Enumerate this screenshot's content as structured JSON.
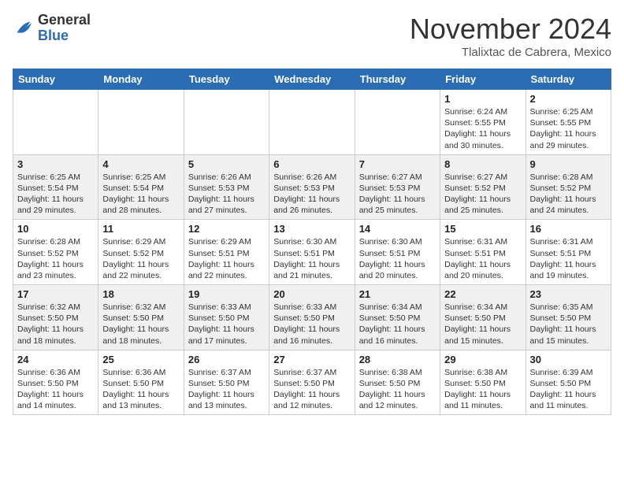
{
  "header": {
    "logo_general": "General",
    "logo_blue": "Blue",
    "month_title": "November 2024",
    "location": "Tlalixtac de Cabrera, Mexico"
  },
  "weekdays": [
    "Sunday",
    "Monday",
    "Tuesday",
    "Wednesday",
    "Thursday",
    "Friday",
    "Saturday"
  ],
  "weeks": [
    [
      {
        "day": "",
        "sunrise": "",
        "sunset": "",
        "daylight": ""
      },
      {
        "day": "",
        "sunrise": "",
        "sunset": "",
        "daylight": ""
      },
      {
        "day": "",
        "sunrise": "",
        "sunset": "",
        "daylight": ""
      },
      {
        "day": "",
        "sunrise": "",
        "sunset": "",
        "daylight": ""
      },
      {
        "day": "",
        "sunrise": "",
        "sunset": "",
        "daylight": ""
      },
      {
        "day": "1",
        "sunrise": "Sunrise: 6:24 AM",
        "sunset": "Sunset: 5:55 PM",
        "daylight": "Daylight: 11 hours and 30 minutes."
      },
      {
        "day": "2",
        "sunrise": "Sunrise: 6:25 AM",
        "sunset": "Sunset: 5:55 PM",
        "daylight": "Daylight: 11 hours and 29 minutes."
      }
    ],
    [
      {
        "day": "3",
        "sunrise": "Sunrise: 6:25 AM",
        "sunset": "Sunset: 5:54 PM",
        "daylight": "Daylight: 11 hours and 29 minutes."
      },
      {
        "day": "4",
        "sunrise": "Sunrise: 6:25 AM",
        "sunset": "Sunset: 5:54 PM",
        "daylight": "Daylight: 11 hours and 28 minutes."
      },
      {
        "day": "5",
        "sunrise": "Sunrise: 6:26 AM",
        "sunset": "Sunset: 5:53 PM",
        "daylight": "Daylight: 11 hours and 27 minutes."
      },
      {
        "day": "6",
        "sunrise": "Sunrise: 6:26 AM",
        "sunset": "Sunset: 5:53 PM",
        "daylight": "Daylight: 11 hours and 26 minutes."
      },
      {
        "day": "7",
        "sunrise": "Sunrise: 6:27 AM",
        "sunset": "Sunset: 5:53 PM",
        "daylight": "Daylight: 11 hours and 25 minutes."
      },
      {
        "day": "8",
        "sunrise": "Sunrise: 6:27 AM",
        "sunset": "Sunset: 5:52 PM",
        "daylight": "Daylight: 11 hours and 25 minutes."
      },
      {
        "day": "9",
        "sunrise": "Sunrise: 6:28 AM",
        "sunset": "Sunset: 5:52 PM",
        "daylight": "Daylight: 11 hours and 24 minutes."
      }
    ],
    [
      {
        "day": "10",
        "sunrise": "Sunrise: 6:28 AM",
        "sunset": "Sunset: 5:52 PM",
        "daylight": "Daylight: 11 hours and 23 minutes."
      },
      {
        "day": "11",
        "sunrise": "Sunrise: 6:29 AM",
        "sunset": "Sunset: 5:52 PM",
        "daylight": "Daylight: 11 hours and 22 minutes."
      },
      {
        "day": "12",
        "sunrise": "Sunrise: 6:29 AM",
        "sunset": "Sunset: 5:51 PM",
        "daylight": "Daylight: 11 hours and 22 minutes."
      },
      {
        "day": "13",
        "sunrise": "Sunrise: 6:30 AM",
        "sunset": "Sunset: 5:51 PM",
        "daylight": "Daylight: 11 hours and 21 minutes."
      },
      {
        "day": "14",
        "sunrise": "Sunrise: 6:30 AM",
        "sunset": "Sunset: 5:51 PM",
        "daylight": "Daylight: 11 hours and 20 minutes."
      },
      {
        "day": "15",
        "sunrise": "Sunrise: 6:31 AM",
        "sunset": "Sunset: 5:51 PM",
        "daylight": "Daylight: 11 hours and 20 minutes."
      },
      {
        "day": "16",
        "sunrise": "Sunrise: 6:31 AM",
        "sunset": "Sunset: 5:51 PM",
        "daylight": "Daylight: 11 hours and 19 minutes."
      }
    ],
    [
      {
        "day": "17",
        "sunrise": "Sunrise: 6:32 AM",
        "sunset": "Sunset: 5:50 PM",
        "daylight": "Daylight: 11 hours and 18 minutes."
      },
      {
        "day": "18",
        "sunrise": "Sunrise: 6:32 AM",
        "sunset": "Sunset: 5:50 PM",
        "daylight": "Daylight: 11 hours and 18 minutes."
      },
      {
        "day": "19",
        "sunrise": "Sunrise: 6:33 AM",
        "sunset": "Sunset: 5:50 PM",
        "daylight": "Daylight: 11 hours and 17 minutes."
      },
      {
        "day": "20",
        "sunrise": "Sunrise: 6:33 AM",
        "sunset": "Sunset: 5:50 PM",
        "daylight": "Daylight: 11 hours and 16 minutes."
      },
      {
        "day": "21",
        "sunrise": "Sunrise: 6:34 AM",
        "sunset": "Sunset: 5:50 PM",
        "daylight": "Daylight: 11 hours and 16 minutes."
      },
      {
        "day": "22",
        "sunrise": "Sunrise: 6:34 AM",
        "sunset": "Sunset: 5:50 PM",
        "daylight": "Daylight: 11 hours and 15 minutes."
      },
      {
        "day": "23",
        "sunrise": "Sunrise: 6:35 AM",
        "sunset": "Sunset: 5:50 PM",
        "daylight": "Daylight: 11 hours and 15 minutes."
      }
    ],
    [
      {
        "day": "24",
        "sunrise": "Sunrise: 6:36 AM",
        "sunset": "Sunset: 5:50 PM",
        "daylight": "Daylight: 11 hours and 14 minutes."
      },
      {
        "day": "25",
        "sunrise": "Sunrise: 6:36 AM",
        "sunset": "Sunset: 5:50 PM",
        "daylight": "Daylight: 11 hours and 13 minutes."
      },
      {
        "day": "26",
        "sunrise": "Sunrise: 6:37 AM",
        "sunset": "Sunset: 5:50 PM",
        "daylight": "Daylight: 11 hours and 13 minutes."
      },
      {
        "day": "27",
        "sunrise": "Sunrise: 6:37 AM",
        "sunset": "Sunset: 5:50 PM",
        "daylight": "Daylight: 11 hours and 12 minutes."
      },
      {
        "day": "28",
        "sunrise": "Sunrise: 6:38 AM",
        "sunset": "Sunset: 5:50 PM",
        "daylight": "Daylight: 11 hours and 12 minutes."
      },
      {
        "day": "29",
        "sunrise": "Sunrise: 6:38 AM",
        "sunset": "Sunset: 5:50 PM",
        "daylight": "Daylight: 11 hours and 11 minutes."
      },
      {
        "day": "30",
        "sunrise": "Sunrise: 6:39 AM",
        "sunset": "Sunset: 5:50 PM",
        "daylight": "Daylight: 11 hours and 11 minutes."
      }
    ]
  ]
}
